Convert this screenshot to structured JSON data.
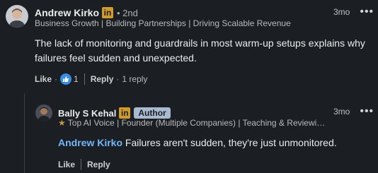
{
  "comment": {
    "author": "Andrew Kirko",
    "linkedin_badge": "in",
    "degree": "• 2nd",
    "headline": "Business Growth | Building Partnerships | Driving Scalable Revenue",
    "time": "3mo",
    "more": "•••",
    "text": "The lack of monitoring and guardrails in most warm-up setups explains why failures feel sudden and unexpected.",
    "like_label": "Like",
    "dot": "·",
    "reactions_count": "1",
    "reply_label": "Reply",
    "replies_text": "1 reply"
  },
  "reply": {
    "author": "Bally S Kehal",
    "linkedin_badge": "in",
    "author_badge": "Author",
    "headline": "Top AI Voice | Founder (Multiple Companies) | Teaching & Reviewi…",
    "time": "3mo",
    "more": "•••",
    "mention": "Andrew Kirko",
    "text": " Failures aren't sudden, they're just unmonitored.",
    "like_label": "Like",
    "reply_label": "Reply"
  },
  "colors": {
    "background": "#1b1f23",
    "mention": "#71b7fb",
    "linkedin_badge": "#cf9b2b",
    "author_badge": "#a9b9cf",
    "like_reaction": "#378fe9"
  }
}
